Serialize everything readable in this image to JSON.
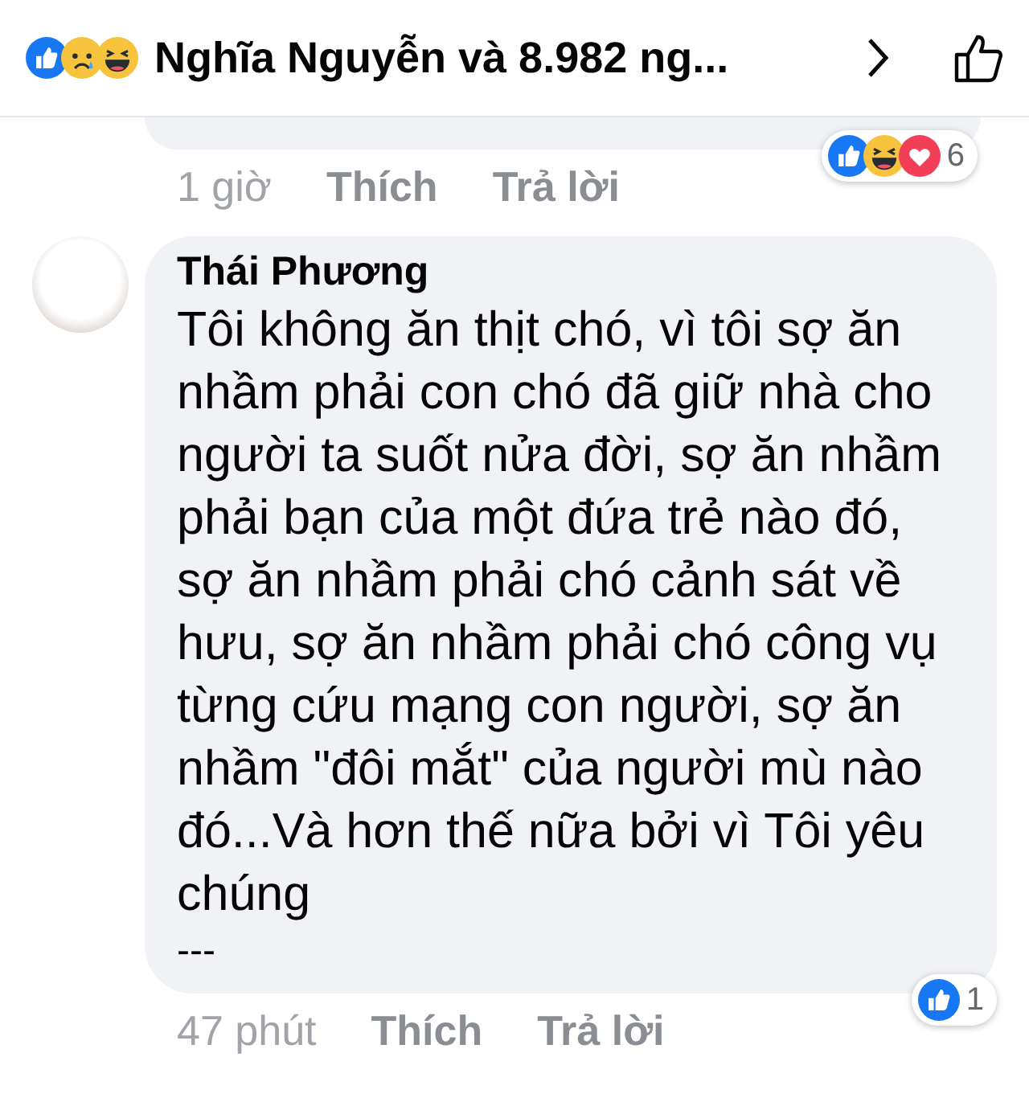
{
  "header": {
    "title": "Nghĩa Nguyễn và 8.982 ng...",
    "reactions": [
      {
        "kind": "like"
      },
      {
        "kind": "sad"
      },
      {
        "kind": "haha"
      }
    ]
  },
  "comments": [
    {
      "kind": "partial",
      "meta": {
        "time": "1 giờ",
        "like": "Thích",
        "reply": "Trả lời"
      },
      "reactions": {
        "icons": [
          {
            "kind": "like"
          },
          {
            "kind": "haha"
          },
          {
            "kind": "love"
          }
        ],
        "count": "6"
      }
    },
    {
      "kind": "full",
      "author": "Thái Phương",
      "text": "Tôi không ăn thịt chó, vì tôi sợ ăn nhầm phải con chó đã giữ nhà cho người ta suốt nửa đời, sợ ăn nhầm phải bạn của một đứa trẻ nào đó, sợ ăn nhầm phải chó cảnh sát về hưu, sợ ăn nhầm phải chó công vụ từng cứu mạng con người, sợ ăn nhầm \"đôi mắt\" của người mù nào đó...Và hơn thế nữa bởi vì Tôi yêu chúng",
      "footer": "---",
      "meta": {
        "time": "47 phút",
        "like": "Thích",
        "reply": "Trả lời"
      },
      "reactions": {
        "icons": [
          {
            "kind": "like"
          }
        ],
        "count": "1"
      }
    }
  ]
}
